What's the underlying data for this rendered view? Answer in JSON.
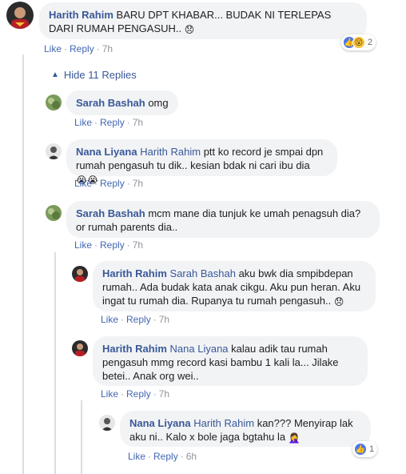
{
  "comments": [
    {
      "author": "Harith Rahim",
      "text": "BARU DPT KHABAR... BUDAK NI TERLEPAS DARI RUMAH PENGASUH..",
      "emoji": "😞",
      "like": "Like",
      "reply": "Reply",
      "time": "7h",
      "reaction_count": "2"
    },
    {
      "author": "Sarah Bashah",
      "text": "omg",
      "like": "Like",
      "reply": "Reply",
      "time": "7h"
    },
    {
      "author": "Nana Liyana",
      "mention": "Harith Rahim",
      "text": "ptt ko record je smpai dpn rumah pengasuh tu dik.. kesian bdak ni cari ibu dia",
      "emoji": "😭😭",
      "like": "Like",
      "reply": "Reply",
      "time": "7h"
    },
    {
      "author": "Sarah Bashah",
      "text": "mcm mane dia tunjuk ke umah penagsuh dia? or rumah parents dia..",
      "like": "Like",
      "reply": "Reply",
      "time": "7h"
    },
    {
      "author": "Harith Rahim",
      "mention": "Sarah Bashah",
      "text": "aku bwk dia smpibdepan rumah.. Ada budak kata anak cikgu. Aku pun heran. Aku ingat tu rumah dia. Rupanya tu rumah pengasuh..",
      "emoji": "😞",
      "like": "Like",
      "reply": "Reply",
      "time": "7h"
    },
    {
      "author": "Harith Rahim",
      "mention": "Nana Liyana",
      "text": "kalau adik tau rumah pengasuh mmg record kasi bambu 1 kali la... Jilake betei.. Anak org wei..",
      "like": "Like",
      "reply": "Reply",
      "time": "7h"
    },
    {
      "author": "Nana Liyana",
      "mention": "Harith Rahim",
      "text": "kan??? Menyirap lak aku ni.. Kalo x bole jaga bgtahu la",
      "emoji": "🤦‍♀️",
      "like": "Like",
      "reply": "Reply",
      "time": "6h",
      "reaction_count": "1"
    }
  ],
  "hide_replies_label": "Hide 11 Replies",
  "icons": {
    "like_reaction": "like-reaction-icon",
    "wow_reaction": "wow-reaction-icon",
    "chevron": "chevron-up-icon"
  },
  "colors": {
    "author": "#385898",
    "action": "#4267b2",
    "bubble": "#f2f3f5"
  }
}
